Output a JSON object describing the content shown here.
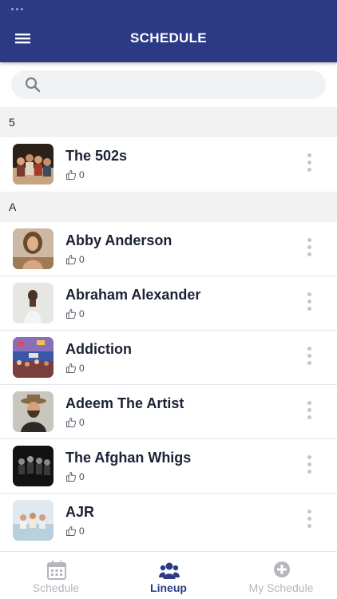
{
  "header": {
    "title": "SCHEDULE",
    "menu_icon": "hamburger-menu-icon"
  },
  "search": {
    "placeholder": "",
    "value": "",
    "icon": "search-icon"
  },
  "sections": [
    {
      "letter": "5",
      "artists": [
        {
          "name": "The 502s",
          "likes": "0",
          "thumb": "band-group-photo"
        }
      ]
    },
    {
      "letter": "A",
      "artists": [
        {
          "name": "Abby Anderson",
          "likes": "0",
          "thumb": "woman-portrait"
        },
        {
          "name": "Abraham Alexander",
          "likes": "0",
          "thumb": "man-portrait"
        },
        {
          "name": "Addiction",
          "likes": "0",
          "thumb": "concert-crowd"
        },
        {
          "name": "Adeem The Artist",
          "likes": "0",
          "thumb": "hat-portrait"
        },
        {
          "name": "The Afghan Whigs",
          "likes": "0",
          "thumb": "band-dark-photo"
        },
        {
          "name": "AJR",
          "likes": "0",
          "thumb": "trio-photo"
        }
      ]
    }
  ],
  "tabbar": {
    "tabs": [
      {
        "label": "Schedule",
        "icon": "calendar-icon",
        "active": false
      },
      {
        "label": "Lineup",
        "icon": "people-icon",
        "active": true
      },
      {
        "label": "My Schedule",
        "icon": "add-circle-icon",
        "active": false
      }
    ]
  },
  "colors": {
    "brand": "#2c3a86",
    "section_bg": "#f2f2f3",
    "inactive_tab": "#b4b6bc"
  }
}
